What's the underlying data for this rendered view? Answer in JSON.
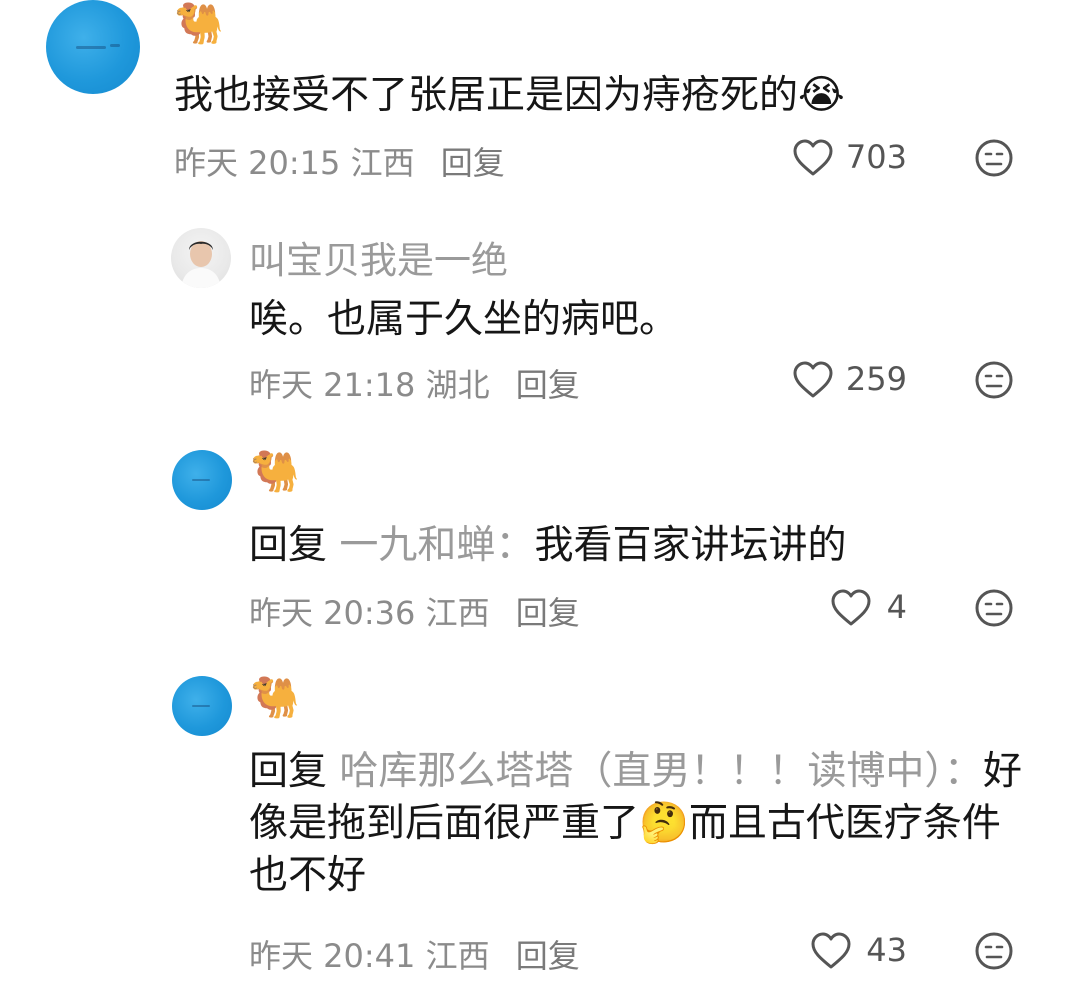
{
  "comments": [
    {
      "username_emoji": "🐫",
      "text": "我也接受不了张居正是因为痔疮死的",
      "text_emoji": "😭",
      "time": "昨天 20:15",
      "location": "江西",
      "reply_label": "回复",
      "likes": "703"
    },
    {
      "username": "叫宝贝我是一绝",
      "text": "唉。也属于久坐的病吧。",
      "time": "昨天 21:18",
      "location": "湖北",
      "reply_label": "回复",
      "likes": "259"
    },
    {
      "username_emoji": "🐫",
      "reply_prefix": "回复",
      "reply_to": "一九和蝉",
      "separator": "：",
      "text": "我看百家讲坛讲的",
      "time": "昨天 20:36",
      "location": "江西",
      "reply_label": "回复",
      "likes": "4"
    },
    {
      "username_emoji": "🐫",
      "reply_prefix": "回复",
      "reply_to": "哈库那么塔塔（直男！！！读博中）",
      "separator": "：",
      "text": "好像是拖到后面很严重了",
      "text_emoji": "🤔",
      "text_2": "而且古代医疗条件也不好",
      "time": "昨天 20:41",
      "location": "江西",
      "reply_label": "回复",
      "likes": "43"
    }
  ],
  "icons": {
    "like": "heart-outline-icon",
    "dislike": "neutral-face-icon"
  }
}
